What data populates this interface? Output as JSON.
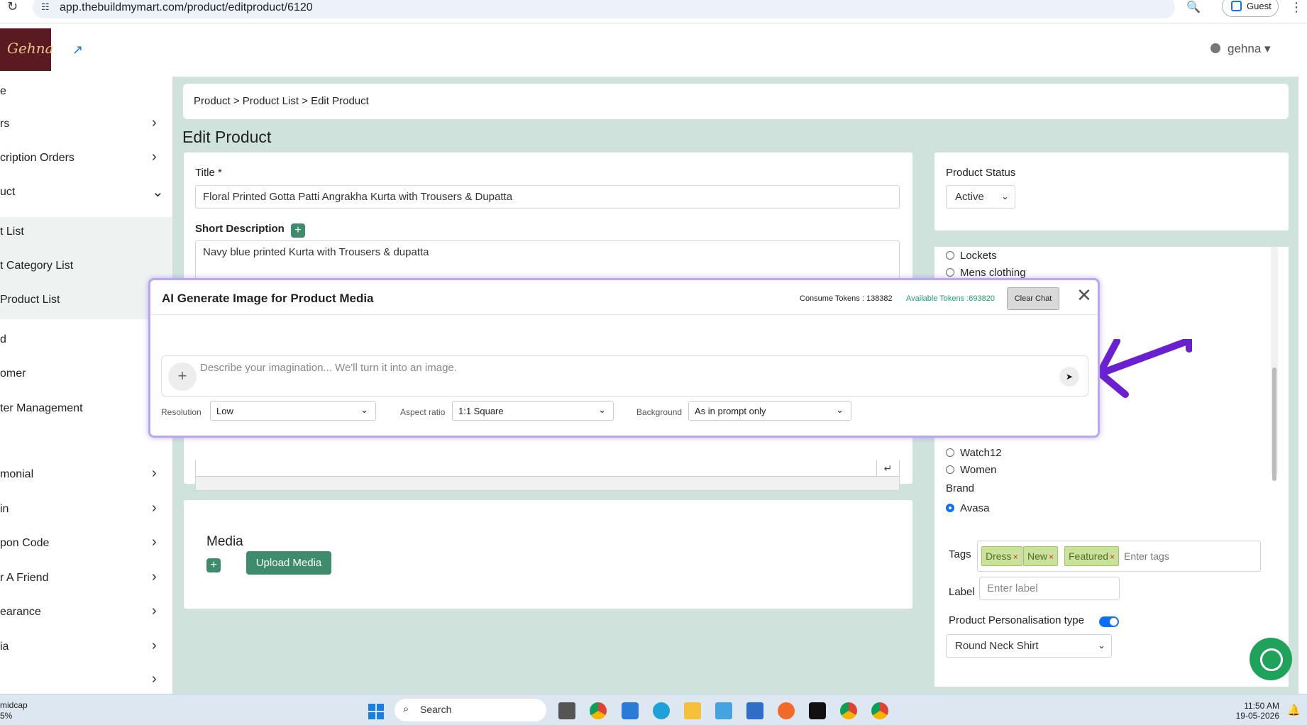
{
  "browser": {
    "url": "app.thebuildmymart.com/product/editproduct/6120",
    "guest_label": "Guest"
  },
  "header": {
    "logo_text": "Gehna",
    "user_name": "gehna"
  },
  "sidebar": {
    "items": [
      {
        "label": "e"
      },
      {
        "label": "rs"
      },
      {
        "label": "cription Orders"
      },
      {
        "label": "uct"
      },
      {
        "label": "t List"
      },
      {
        "label": "t Category List"
      },
      {
        "label": "Product List"
      },
      {
        "label": "d"
      },
      {
        "label": "omer"
      },
      {
        "label": "ter Management"
      },
      {
        "label": "monial"
      },
      {
        "label": "in"
      },
      {
        "label": "pon Code"
      },
      {
        "label": "r A Friend"
      },
      {
        "label": "earance"
      },
      {
        "label": "ia"
      }
    ]
  },
  "breadcrumb": "Product > Product List > Edit Product",
  "page_title": "Edit Product",
  "form": {
    "title_label": "Title *",
    "title_value": "Floral Printed Gotta Patti Angrakha Kurta with Trousers & Dupatta",
    "short_desc_label": "Short Description",
    "short_desc_value": "Navy blue printed Kurta with Trousers & dupatta"
  },
  "media": {
    "title": "Media",
    "upload_label": "Upload Media"
  },
  "status": {
    "label": "Product Status",
    "value": "Active"
  },
  "categories": {
    "items_top": [
      "Lockets",
      "Mens clothing"
    ],
    "items_bottom": [
      "Watch12",
      "Women"
    ]
  },
  "brand": {
    "label": "Brand",
    "selected": "Avasa"
  },
  "tags": {
    "label": "Tags",
    "items": [
      "Dress",
      "New",
      "Featured"
    ],
    "placeholder": "Enter tags"
  },
  "label_field": {
    "label": "Label",
    "placeholder": "Enter label"
  },
  "personalisation": {
    "label": "Product Personalisation type",
    "enabled": true,
    "value": "Round Neck Shirt"
  },
  "modal": {
    "title": "AI Generate Image for Product Media",
    "consume_tokens": "Consume Tokens : 138382",
    "available_tokens": "Available Tokens :693820",
    "clear_chat": "Clear Chat",
    "prompt_placeholder": "Describe your imagination... We'll turn it into an image.",
    "resolution_label": "Resolution",
    "resolution_value": "Low",
    "aspect_label": "Aspect ratio",
    "aspect_value": "1:1 Square",
    "background_label": "Background",
    "background_value": "As in prompt only"
  },
  "taskbar": {
    "weather_line1": "midcap",
    "weather_line2": "5%",
    "search_label": "Search",
    "time": "11:50 AM",
    "date": "19-05-2026"
  },
  "colors": {
    "accent_green": "#3e8c6b",
    "main_bg": "#cfe3dc",
    "annotation_arrow": "#6a1fd0",
    "modal_border": "#b9a7f0"
  }
}
